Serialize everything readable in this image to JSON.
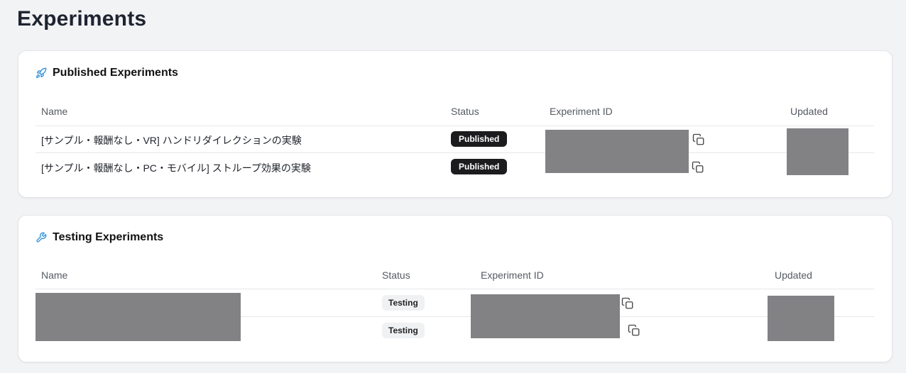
{
  "page": {
    "title": "Experiments"
  },
  "published": {
    "title": "Published Experiments",
    "icon": "rocket-icon",
    "columns": {
      "name": "Name",
      "status": "Status",
      "id": "Experiment ID",
      "updated": "Updated"
    },
    "rows": [
      {
        "name": "[サンプル・報酬なし・VR] ハンドリダイレクションの実験",
        "status": "Published"
      },
      {
        "name": "[サンプル・報酬なし・PC・モバイル] ストループ効果の実験",
        "status": "Published"
      }
    ]
  },
  "testing": {
    "title": "Testing Experiments",
    "icon": "wrench-icon",
    "columns": {
      "name": "Name",
      "status": "Status",
      "id": "Experiment ID",
      "updated": "Updated"
    },
    "rows": [
      {
        "status": "Testing"
      },
      {
        "status": "Testing"
      }
    ]
  },
  "colors": {
    "accent": "#2d8fd5",
    "redacted": "#828285",
    "published_badge": "#1c1c1e",
    "testing_badge": "#f0f1f3"
  }
}
